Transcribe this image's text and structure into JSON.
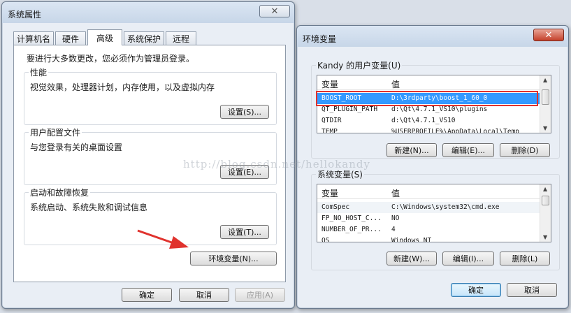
{
  "sys_props": {
    "title": "系统属性",
    "tabs": [
      "计算机名",
      "硬件",
      "高级",
      "系统保护",
      "远程"
    ],
    "admin_notice": "要进行大多数更改，您必须作为管理员登录。",
    "performance": {
      "legend": "性能",
      "desc": "视觉效果，处理器计划，内存使用，以及虚拟内存",
      "button": "设置(S)..."
    },
    "user_profile": {
      "legend": "用户配置文件",
      "desc": "与您登录有关的桌面设置",
      "button": "设置(E)..."
    },
    "startup": {
      "legend": "启动和故障恢复",
      "desc": "系统启动、系统失败和调试信息",
      "button": "设置(T)..."
    },
    "env_button": "环境变量(N)...",
    "ok": "确定",
    "cancel": "取消",
    "apply": "应用(A)"
  },
  "env_vars": {
    "title": "环境变量",
    "user_legend": "Kandy 的用户变量(U)",
    "col_var": "变量",
    "col_val": "值",
    "user_rows": [
      {
        "name": "BOOST_ROOT",
        "value": "D:\\3rdparty\\boost_1_60_0"
      },
      {
        "name": "QT_PLUGIN_PATH",
        "value": "d:\\Qt\\4.7.1_VS10\\plugins"
      },
      {
        "name": "QTDIR",
        "value": "d:\\Qt\\4.7.1_VS10"
      },
      {
        "name": "TEMP",
        "value": "%USERPROFILE%\\AppData\\Local\\Temp"
      }
    ],
    "user_new": "新建(N)...",
    "user_edit": "编辑(E)...",
    "user_delete": "删除(D)",
    "sys_legend": "系统变量(S)",
    "sys_rows": [
      {
        "name": "ComSpec",
        "value": "C:\\Windows\\system32\\cmd.exe"
      },
      {
        "name": "FP_NO_HOST_C...",
        "value": "NO"
      },
      {
        "name": "NUMBER_OF_PR...",
        "value": "4"
      },
      {
        "name": "OS",
        "value": "Windows_NT"
      }
    ],
    "sys_new": "新建(W)...",
    "sys_edit": "编辑(I)...",
    "sys_delete": "删除(L)",
    "ok": "确定",
    "cancel": "取消"
  },
  "watermark": "http://blog.csdn.net/hellokandy",
  "colors": {
    "selection": "#3399ff",
    "highlight_box": "#e0322d",
    "arrow": "#e0322d"
  }
}
